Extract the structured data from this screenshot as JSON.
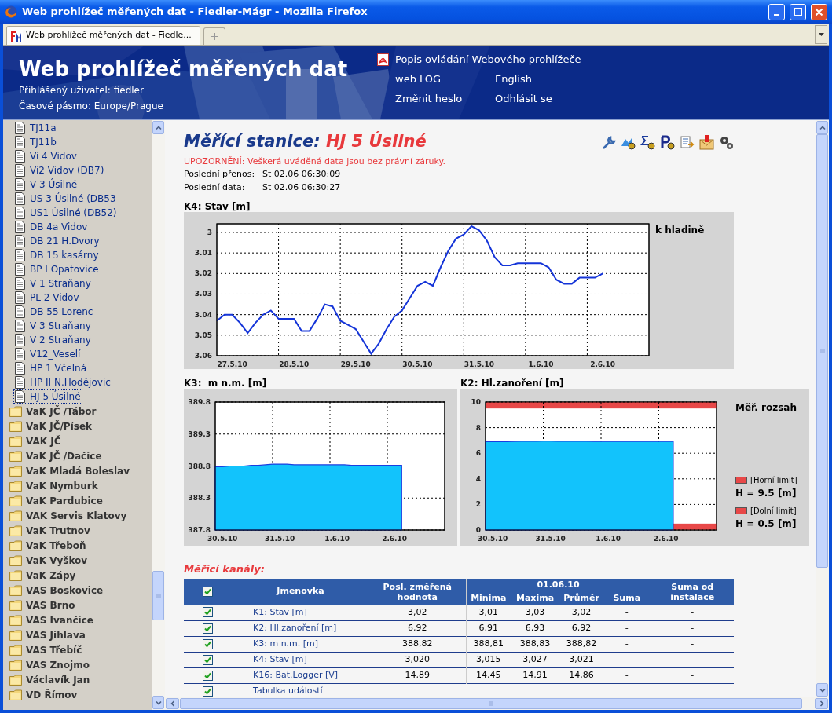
{
  "window": {
    "title": "Web prohlížeč měřených dat - Fiedler-Mágr - Mozilla Firefox"
  },
  "tabs": [
    {
      "label": "Web prohlížeč měřených dat - Fiedle...",
      "selected": true
    }
  ],
  "header": {
    "title": "Web prohlížeč měřených dat",
    "user": "Přihlášený uživatel: fiedler",
    "timezone": "Časové pásmo: Europe/Prague",
    "links": [
      {
        "label": "Popis ovládání Webového prohlížeče",
        "kind": "pdf"
      },
      {
        "label": "web LOG",
        "kind": "plain"
      },
      {
        "label": "English",
        "kind": "plain"
      },
      {
        "label": "Změnit heslo",
        "kind": "plain"
      },
      {
        "label": "Odhlásit se",
        "kind": "plain"
      }
    ]
  },
  "sidebar": {
    "items": [
      {
        "label": "TJ11a",
        "kind": "station",
        "selected": false
      },
      {
        "label": "TJ11b",
        "kind": "station",
        "selected": false
      },
      {
        "label": "Vi 4 Vidov",
        "kind": "station",
        "selected": false
      },
      {
        "label": "Vi2 Vidov (DB7)",
        "kind": "station",
        "selected": false
      },
      {
        "label": "V 3 Úsilné",
        "kind": "station",
        "selected": false
      },
      {
        "label": "US 3 Úsilné (DB53",
        "kind": "station",
        "selected": false
      },
      {
        "label": "US1 Úsilné (DB52)",
        "kind": "station",
        "selected": false
      },
      {
        "label": "DB 4a Vidov",
        "kind": "station",
        "selected": false
      },
      {
        "label": "DB 21 H.Dvory",
        "kind": "station",
        "selected": false
      },
      {
        "label": "DB 15 kasárny",
        "kind": "station",
        "selected": false
      },
      {
        "label": "BP I Opatovice",
        "kind": "station",
        "selected": false
      },
      {
        "label": "V 1 Straňany",
        "kind": "station",
        "selected": false
      },
      {
        "label": "PL 2 Vidov",
        "kind": "station",
        "selected": false
      },
      {
        "label": "DB 55 Lorenc",
        "kind": "station",
        "selected": false
      },
      {
        "label": "V 3 Straňany",
        "kind": "station",
        "selected": false
      },
      {
        "label": "V 2 Straňany",
        "kind": "station",
        "selected": false
      },
      {
        "label": "V12_Veselí",
        "kind": "station",
        "selected": false
      },
      {
        "label": "HP 1 Včelná",
        "kind": "station",
        "selected": false
      },
      {
        "label": "HP II N.Hodějovic",
        "kind": "station",
        "selected": false
      },
      {
        "label": "HJ 5 Úsilné",
        "kind": "station",
        "selected": true
      },
      {
        "label": "VaK JČ /Tábor",
        "kind": "folder",
        "selected": false
      },
      {
        "label": "VaK JČ/Písek",
        "kind": "folder",
        "selected": false
      },
      {
        "label": "VAK JČ",
        "kind": "folder",
        "selected": false
      },
      {
        "label": "VaK JČ /Dačice",
        "kind": "folder",
        "selected": false
      },
      {
        "label": "VaK Mladá Boleslav",
        "kind": "folder",
        "selected": false
      },
      {
        "label": "VaK Nymburk",
        "kind": "folder",
        "selected": false
      },
      {
        "label": "VaK Pardubice",
        "kind": "folder",
        "selected": false
      },
      {
        "label": "VAK Servis Klatovy",
        "kind": "folder",
        "selected": false
      },
      {
        "label": "VaK Trutnov",
        "kind": "folder",
        "selected": false
      },
      {
        "label": "VaK Třeboň",
        "kind": "folder",
        "selected": false
      },
      {
        "label": "VaK Vyškov",
        "kind": "folder",
        "selected": false
      },
      {
        "label": "VaK Zápy",
        "kind": "folder",
        "selected": false
      },
      {
        "label": "VAS Boskovice",
        "kind": "folder",
        "selected": false
      },
      {
        "label": "VAS Brno",
        "kind": "folder",
        "selected": false
      },
      {
        "label": "VAS Ivančice",
        "kind": "folder",
        "selected": false
      },
      {
        "label": "VAS Jihlava",
        "kind": "folder",
        "selected": false
      },
      {
        "label": "VAS Třebíč",
        "kind": "folder",
        "selected": false
      },
      {
        "label": "VAS Znojmo",
        "kind": "folder",
        "selected": false
      },
      {
        "label": "Václavík Jan",
        "kind": "folder",
        "selected": false
      },
      {
        "label": "VD Římov",
        "kind": "folder",
        "selected": false
      }
    ]
  },
  "station": {
    "label": "Měřící stanice:",
    "name": "HJ 5 Úsilné",
    "warning": "UPOZORNĚNÍ: Veškerá uváděná data jsou bez právní záruky.",
    "info": [
      {
        "label": "Poslední přenos:",
        "value": "St 02.06 06:30:09"
      },
      {
        "label": "Poslední data:",
        "value": "St 02.06 06:30:27"
      }
    ]
  },
  "charts": [
    {
      "title": "K4: Stav [m]",
      "legend_title": "k hladině",
      "chart_data": {
        "type": "line",
        "grid": true,
        "categories": [
          null,
          null,
          "27.5.10",
          null,
          null,
          null,
          null,
          null,
          null,
          null,
          "28.5.10",
          null,
          null,
          null,
          null,
          null,
          null,
          null,
          "29.5.10",
          null,
          null,
          null,
          null,
          null,
          null,
          null,
          "30.5.10",
          null,
          null,
          null,
          null,
          null,
          null,
          null,
          "31.5.10",
          null,
          null,
          null,
          null,
          null,
          null,
          null,
          "1.6.10",
          null,
          null,
          null,
          null,
          null,
          null,
          null,
          "2.6.10",
          null,
          null,
          null,
          null,
          null
        ],
        "series": [
          {
            "color": "#1434d8",
            "values": [
              3.043,
              3.04,
              3.04,
              3.044,
              3.049,
              3.044,
              3.04,
              3.038,
              3.042,
              3.042,
              3.042,
              3.048,
              3.048,
              3.042,
              3.035,
              3.036,
              3.043,
              3.045,
              3.047,
              3.053,
              3.059,
              3.054,
              3.047,
              3.041,
              3.038,
              3.032,
              3.026,
              3.024,
              3.026,
              3.017,
              3.009,
              3.003,
              3.001,
              2.997,
              2.999,
              3.004,
              3.012,
              3.016,
              3.016,
              3.015,
              3.015,
              3.015,
              3.015,
              3.017,
              3.023,
              3.025,
              3.025,
              3.022,
              3.022,
              3.022,
              3.02,
              null,
              null,
              null,
              null,
              null
            ]
          }
        ],
        "ylim": [
          3.06,
          2.9958
        ],
        "yticks": [
          3,
          3.01,
          3.02,
          3.03,
          3.04,
          3.05,
          3.06
        ]
      }
    },
    {
      "title": "K3:  m n.m. [m]",
      "chart_data": {
        "type": "area",
        "grid": true,
        "categories": [
          null,
          "30.5.10",
          null,
          null,
          null,
          null,
          null,
          null,
          null,
          "31.5.10",
          null,
          null,
          null,
          null,
          null,
          null,
          null,
          "1.6.10",
          null,
          null,
          null,
          null,
          null,
          null,
          null,
          "2.6.10",
          null,
          null,
          null,
          null,
          null,
          null
        ],
        "series": [
          {
            "color": "#12c3fc",
            "values": [
              388.79,
              388.79,
              388.8,
              388.8,
              388.8,
              388.81,
              388.81,
              388.82,
              388.83,
              388.83,
              388.83,
              388.82,
              388.82,
              388.82,
              388.82,
              388.82,
              388.82,
              388.82,
              388.82,
              388.81,
              388.81,
              388.81,
              388.81,
              388.81,
              388.81,
              388.81,
              388.81,
              null,
              null,
              null,
              null,
              null
            ]
          }
        ],
        "ylim": [
          387.8,
          389.8
        ],
        "yticks": [
          387.8,
          388.3,
          388.8,
          389.3,
          389.8
        ]
      }
    },
    {
      "title": "K2: Hl.zanoření [m]",
      "legend_title": "Měř. rozsah",
      "legend": [
        {
          "label": "[Horní limit]",
          "value": "H = 9.5 [m]"
        },
        {
          "label": "[Dolní limit]",
          "value": "H = 0.5 [m]"
        }
      ],
      "chart_data": {
        "type": "area",
        "grid": true,
        "categories": [
          null,
          "30.5.10",
          null,
          null,
          null,
          null,
          null,
          null,
          null,
          "31.5.10",
          null,
          null,
          null,
          null,
          null,
          null,
          null,
          "1.6.10",
          null,
          null,
          null,
          null,
          null,
          null,
          null,
          "2.6.10",
          null,
          null,
          null,
          null,
          null,
          null
        ],
        "series": [
          {
            "color": "#12c3fc",
            "values": [
              6.9,
              6.9,
              6.91,
              6.91,
              6.92,
              6.93,
              6.93,
              6.94,
              6.95,
              6.95,
              6.94,
              6.94,
              6.93,
              6.93,
              6.93,
              6.92,
              6.92,
              6.92,
              6.92,
              6.92,
              6.92,
              6.92,
              6.92,
              6.92,
              6.92,
              6.92,
              6.92,
              null,
              null,
              null,
              null,
              null
            ]
          }
        ],
        "ylim": [
          0,
          10
        ],
        "yticks": [
          0,
          2,
          4,
          6,
          8,
          10
        ],
        "bands": [
          {
            "axis": "y",
            "from": 9.5,
            "to": 10,
            "color": "#e84848"
          },
          {
            "axis": "y",
            "from": 0,
            "to": 0.5,
            "color": "#e84848"
          }
        ]
      }
    }
  ],
  "channels": {
    "title": "Měřicí kanály:",
    "header": {
      "all_checked": true,
      "name": "Jmenovka",
      "last": "Posl. změřená hodnota",
      "date": "01.06.10",
      "stats": [
        "Minima",
        "Maxima",
        "Průměr",
        "Suma"
      ],
      "total": "Suma od instalace"
    },
    "rows": [
      {
        "kind": "channel",
        "checked": true,
        "name": "K1: Stav [m]",
        "last": "3,02",
        "values": [
          "3,01",
          "3,03",
          "3,02",
          "-"
        ],
        "total": "-"
      },
      {
        "kind": "channel",
        "checked": true,
        "name": "K2: Hl.zanoření [m]",
        "last": "6,92",
        "values": [
          "6,91",
          "6,93",
          "6,92",
          "-"
        ],
        "total": "-"
      },
      {
        "kind": "channel",
        "checked": true,
        "name": "K3: m n.m. [m]",
        "last": "388,82",
        "values": [
          "388,81",
          "388,83",
          "388,82",
          "-"
        ],
        "total": "-"
      },
      {
        "kind": "channel",
        "checked": true,
        "name": "K4: Stav [m]",
        "last": "3,020",
        "values": [
          "3,015",
          "3,027",
          "3,021",
          "-"
        ],
        "total": "-"
      },
      {
        "kind": "channel",
        "checked": true,
        "name": "K16: Bat.Logger [V]",
        "last": "14,89",
        "values": [
          "14,45",
          "14,91",
          "14,86",
          "-"
        ],
        "total": "-"
      },
      {
        "kind": "events",
        "checked": true,
        "name": "Tabulka událostí"
      }
    ]
  }
}
